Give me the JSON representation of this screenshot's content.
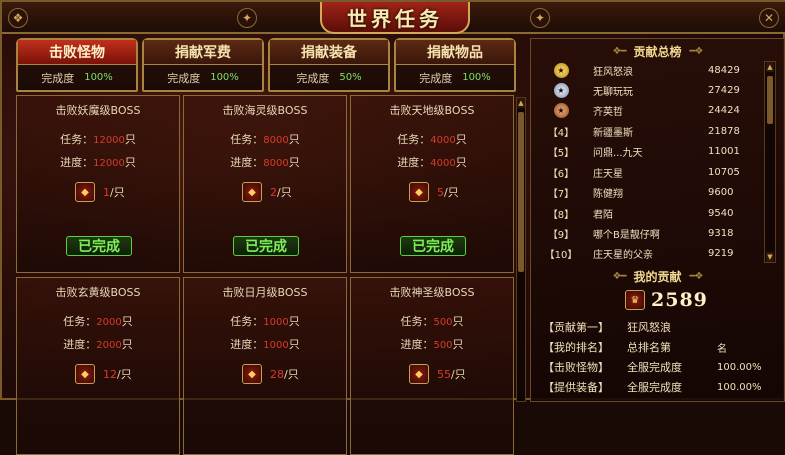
{
  "window": {
    "title": "世界任务"
  },
  "tabs": [
    {
      "label": "击败怪物",
      "progress_label": "完成度",
      "progress": "100%",
      "active": true
    },
    {
      "label": "捐献军费",
      "progress_label": "完成度",
      "progress": "100%",
      "active": false
    },
    {
      "label": "捐献装备",
      "progress_label": "完成度",
      "progress": "50%",
      "active": false
    },
    {
      "label": "捐献物品",
      "progress_label": "完成度",
      "progress": "100%",
      "active": false
    }
  ],
  "tasks": [
    {
      "title": "击败妖魔级BOSS",
      "task_label": "任务：",
      "task_value": "12000",
      "progress_label": "进度：",
      "progress_value": "12000",
      "unit": "只",
      "reward_count": "1",
      "reward_unit": "/只",
      "status": "已完成"
    },
    {
      "title": "击败海灵级BOSS",
      "task_label": "任务：",
      "task_value": "8000",
      "progress_label": "进度：",
      "progress_value": "8000",
      "unit": "只",
      "reward_count": "2",
      "reward_unit": "/只",
      "status": "已完成"
    },
    {
      "title": "击败天地级BOSS",
      "task_label": "任务：",
      "task_value": "4000",
      "progress_label": "进度：",
      "progress_value": "4000",
      "unit": "只",
      "reward_count": "5",
      "reward_unit": "/只",
      "status": "已完成"
    },
    {
      "title": "击败玄黄级BOSS",
      "task_label": "任务：",
      "task_value": "2000",
      "progress_label": "进度：",
      "progress_value": "2000",
      "unit": "只",
      "reward_count": "12",
      "reward_unit": "/只",
      "status": ""
    },
    {
      "title": "击败日月级BOSS",
      "task_label": "任务：",
      "task_value": "1000",
      "progress_label": "进度：",
      "progress_value": "1000",
      "unit": "只",
      "reward_count": "28",
      "reward_unit": "/只",
      "status": ""
    },
    {
      "title": "击败神圣级BOSS",
      "task_label": "任务：",
      "task_value": "500",
      "progress_label": "进度：",
      "progress_value": "500",
      "unit": "只",
      "reward_count": "55",
      "reward_unit": "/只",
      "status": ""
    }
  ],
  "ranking": {
    "title": "贡献总榜",
    "rows": [
      {
        "rank": "",
        "medal": "gold-medal-icon",
        "name": "狂风怒浪",
        "score": "48429"
      },
      {
        "rank": "",
        "medal": "silver-medal-icon",
        "name": "无聊玩玩",
        "score": "27429"
      },
      {
        "rank": "",
        "medal": "bronze-medal-icon",
        "name": "齐英哲",
        "score": "24424"
      },
      {
        "rank": "【4】",
        "name": "新疆墨斯",
        "score": "21878"
      },
      {
        "rank": "【5】",
        "name": "问鼎...九天",
        "score": "11001"
      },
      {
        "rank": "【6】",
        "name": "庄天星",
        "score": "10705"
      },
      {
        "rank": "【7】",
        "name": "陈健翔",
        "score": "9600"
      },
      {
        "rank": "【8】",
        "name": "君陌",
        "score": "9540"
      },
      {
        "rank": "【9】",
        "name": "哪个B是靓仔啊",
        "score": "9318"
      },
      {
        "rank": "【10】",
        "name": "庄天星的父亲",
        "score": "9219"
      }
    ]
  },
  "my_contribution": {
    "title": "我的贡献",
    "score": "2589",
    "stats": [
      {
        "label": "【贡献第一】",
        "value1": "狂风怒浪",
        "value2": ""
      },
      {
        "label": "【我的排名】",
        "value1": "总排名第",
        "value2": "名"
      },
      {
        "label": "【击败怪物】",
        "value1": "全服完成度",
        "value2": "100.00%"
      },
      {
        "label": "【提供装备】",
        "value1": "全服完成度",
        "value2": "100.00%"
      }
    ]
  }
}
